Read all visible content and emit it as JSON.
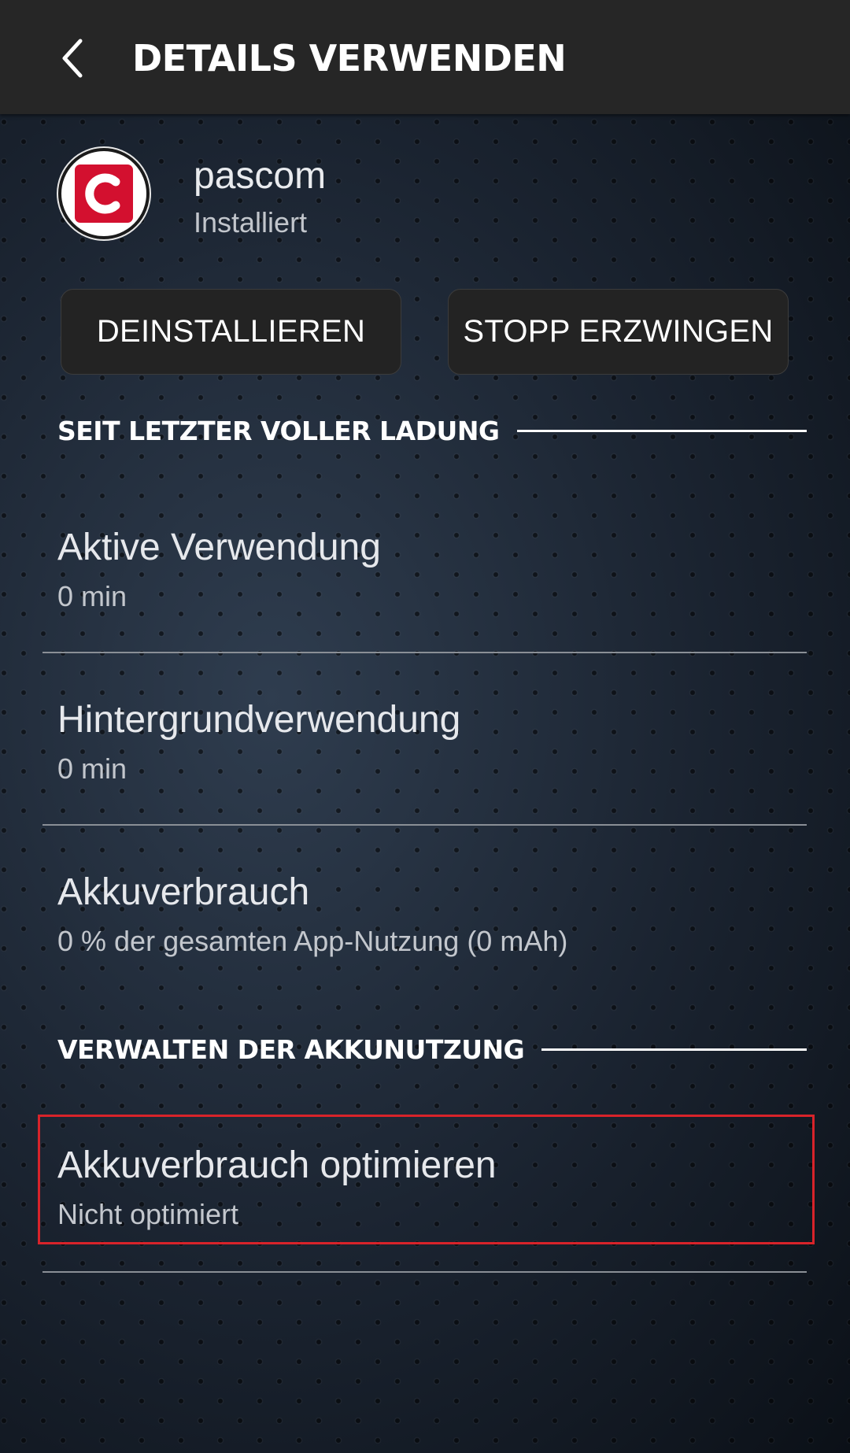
{
  "header": {
    "back_icon": "chevron-left-icon",
    "title": "DETAILS VERWENDEN"
  },
  "app": {
    "icon": "pascom-app-icon",
    "icon_color": "#d3102f",
    "name": "pascom",
    "status": "Installiert"
  },
  "actions": {
    "uninstall_label": "DEINSTALLIEREN",
    "force_stop_label": "STOPP ERZWINGEN"
  },
  "sections": {
    "since_full_charge": "SEIT LETZTER VOLLER LADUNG",
    "battery_management": "VERWALTEN DER AKKUNUTZUNG"
  },
  "usage_items": [
    {
      "title": "Aktive Verwendung",
      "value": "0 min"
    },
    {
      "title": "Hintergrundverwendung",
      "value": "0 min"
    },
    {
      "title": "Akkuverbrauch",
      "value": "0 % der gesamten App-Nutzung (0 mAh)"
    }
  ],
  "optimize": {
    "title": "Akkuverbrauch optimieren",
    "value": "Nicht optimiert",
    "highlight_color": "#d8232a"
  }
}
